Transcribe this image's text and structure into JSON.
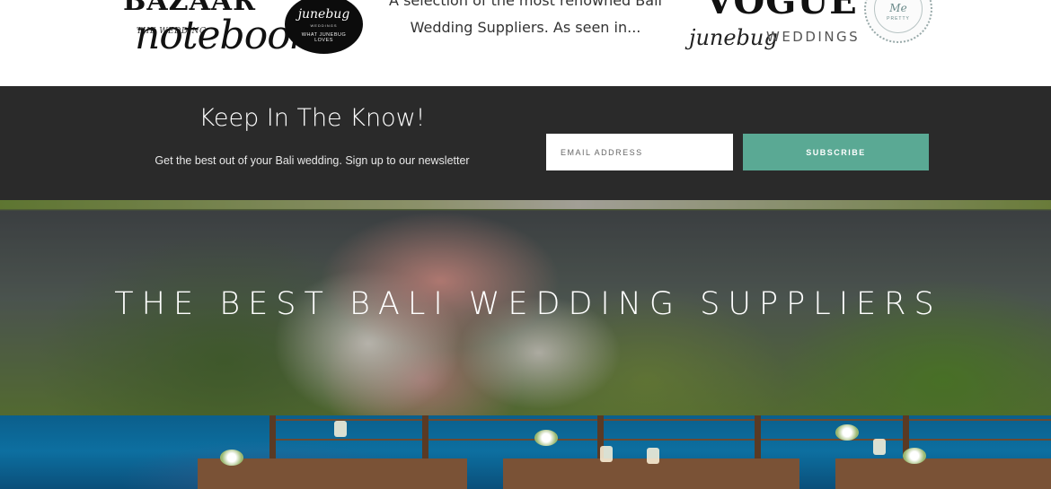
{
  "logos": {
    "bazaar": "BAZAAR",
    "the_wedding": "THE WEDDING",
    "notebook": "notebook",
    "junebug_badge_brand": "junebug",
    "junebug_badge_sub": "WEDDINGS",
    "junebug_badge_footer": "WHAT JUNEBUG LOVES",
    "vogue": "VOGUE",
    "junebug": "junebug",
    "weddings": "WEDDINGS",
    "smp_script": "Me",
    "smp_text": "PRETTY"
  },
  "intro_text": "A selection of the most renowned Bali Wedding Suppliers. As seen in...",
  "newsletter": {
    "title": "Keep In The Know!",
    "subtitle": "Get the best out of your Bali wedding. Sign up to our newsletter",
    "email_placeholder": "EMAIL ADDRESS",
    "subscribe_label": "SUBSCRIBE",
    "button_color": "#5aa994",
    "background_color": "#2a2a2a"
  },
  "hero": {
    "title": "THE BEST BALI WEDDING SUPPLIERS"
  }
}
